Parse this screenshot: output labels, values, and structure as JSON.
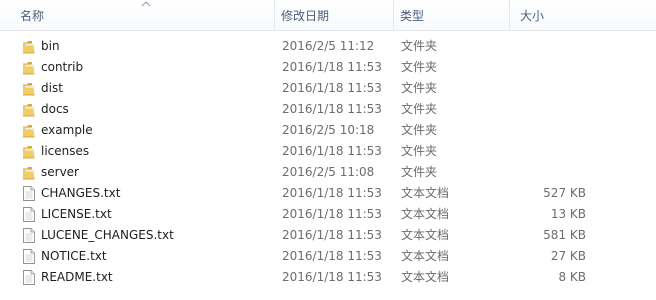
{
  "columns": {
    "name": "名称",
    "date": "修改日期",
    "type": "类型",
    "size": "大小"
  },
  "sort": {
    "column": "name",
    "direction": "ascending",
    "icon": "sort-up-icon"
  },
  "colors": {
    "folder": "#e9c15a",
    "header_text": "#4c607a",
    "detail_text": "#6d6d6d"
  },
  "files": [
    {
      "name": "bin",
      "date": "2016/2/5 11:12",
      "type": "文件夹",
      "size": "",
      "icon": "folder-icon"
    },
    {
      "name": "contrib",
      "date": "2016/1/18 11:53",
      "type": "文件夹",
      "size": "",
      "icon": "folder-icon"
    },
    {
      "name": "dist",
      "date": "2016/1/18 11:53",
      "type": "文件夹",
      "size": "",
      "icon": "folder-icon"
    },
    {
      "name": "docs",
      "date": "2016/1/18 11:53",
      "type": "文件夹",
      "size": "",
      "icon": "folder-icon"
    },
    {
      "name": "example",
      "date": "2016/2/5 10:18",
      "type": "文件夹",
      "size": "",
      "icon": "folder-icon"
    },
    {
      "name": "licenses",
      "date": "2016/1/18 11:53",
      "type": "文件夹",
      "size": "",
      "icon": "folder-icon"
    },
    {
      "name": "server",
      "date": "2016/2/5 11:08",
      "type": "文件夹",
      "size": "",
      "icon": "folder-icon"
    },
    {
      "name": "CHANGES.txt",
      "date": "2016/1/18 11:53",
      "type": "文本文档",
      "size": "527 KB",
      "icon": "text-file-icon"
    },
    {
      "name": "LICENSE.txt",
      "date": "2016/1/18 11:53",
      "type": "文本文档",
      "size": "13 KB",
      "icon": "text-file-icon"
    },
    {
      "name": "LUCENE_CHANGES.txt",
      "date": "2016/1/18 11:53",
      "type": "文本文档",
      "size": "581 KB",
      "icon": "text-file-icon"
    },
    {
      "name": "NOTICE.txt",
      "date": "2016/1/18 11:53",
      "type": "文本文档",
      "size": "27 KB",
      "icon": "text-file-icon"
    },
    {
      "name": "README.txt",
      "date": "2016/1/18 11:53",
      "type": "文本文档",
      "size": "8 KB",
      "icon": "text-file-icon"
    }
  ]
}
